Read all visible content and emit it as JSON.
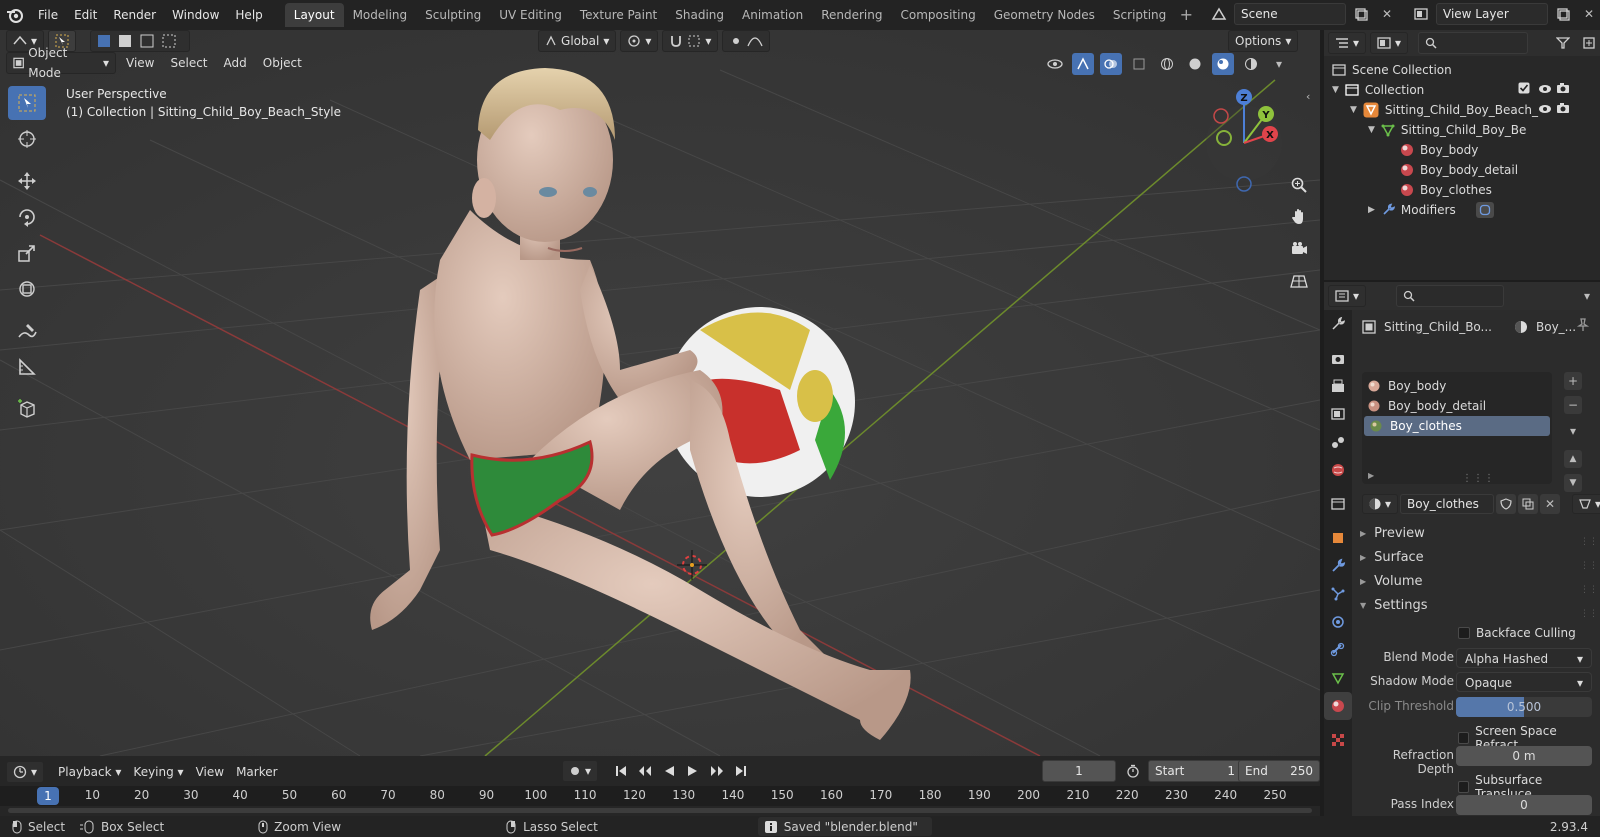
{
  "top_menu": [
    "File",
    "Edit",
    "Render",
    "Window",
    "Help"
  ],
  "workspaces": [
    "Layout",
    "Modeling",
    "Sculpting",
    "UV Editing",
    "Texture Paint",
    "Shading",
    "Animation",
    "Rendering",
    "Compositing",
    "Geometry Nodes",
    "Scripting"
  ],
  "active_workspace": "Layout",
  "scene": "Scene",
  "view_layer": "View Layer",
  "viewport": {
    "mode": "Object Mode",
    "menus": [
      "View",
      "Select",
      "Add",
      "Object"
    ],
    "orientation": "Global",
    "options": "Options",
    "perspective": "User Perspective",
    "collection_info": "(1) Collection | Sitting_Child_Boy_Beach_Style",
    "gizmo": {
      "x": "X",
      "y": "Y",
      "z": "Z"
    }
  },
  "outliner": {
    "scene_collection": "Scene Collection",
    "collection": "Collection",
    "object": "Sitting_Child_Boy_Beach_",
    "mesh": "Sitting_Child_Boy_Be",
    "materials": [
      "Boy_body",
      "Boy_body_detail",
      "Boy_clothes"
    ],
    "modifiers": "Modifiers"
  },
  "properties": {
    "breadcrumb_object": "Sitting_Child_Bo...",
    "breadcrumb_material": "Boy_...",
    "material_slots": [
      "Boy_body",
      "Boy_body_detail",
      "Boy_clothes"
    ],
    "selected_slot": "Boy_clothes",
    "material_name": "Boy_clothes",
    "sections": {
      "preview": "Preview",
      "surface": "Surface",
      "volume": "Volume",
      "settings": "Settings"
    },
    "backface_culling": "Backface Culling",
    "blend_mode_label": "Blend Mode",
    "blend_mode": "Alpha Hashed",
    "shadow_mode_label": "Shadow Mode",
    "shadow_mode": "Opaque",
    "clip_threshold_label": "Clip Threshold",
    "clip_threshold": "0.500",
    "clip_threshold_fraction": 0.5,
    "screen_space_refraction": "Screen Space Refract...",
    "refraction_depth_label": "Refraction Depth",
    "refraction_depth": "0 m",
    "subsurface_translucency": "Subsurface Transluce...",
    "pass_index_label": "Pass Index",
    "pass_index": "0"
  },
  "timeline": {
    "menus": [
      "Playback",
      "Keying",
      "View",
      "Marker"
    ],
    "current_frame": "1",
    "start_label": "Start",
    "start": "1",
    "end_label": "End",
    "end": "250",
    "ticks": [
      "10",
      "20",
      "30",
      "40",
      "50",
      "60",
      "70",
      "80",
      "90",
      "100",
      "110",
      "120",
      "130",
      "140",
      "150",
      "160",
      "170",
      "180",
      "190",
      "200",
      "210",
      "220",
      "230",
      "240",
      "250"
    ]
  },
  "statusbar": {
    "select": "Select",
    "box_select": "Box Select",
    "zoom_view": "Zoom View",
    "lasso_select": "Lasso Select",
    "message": "Saved \"blender.blend\"",
    "version": "2.93.4"
  }
}
